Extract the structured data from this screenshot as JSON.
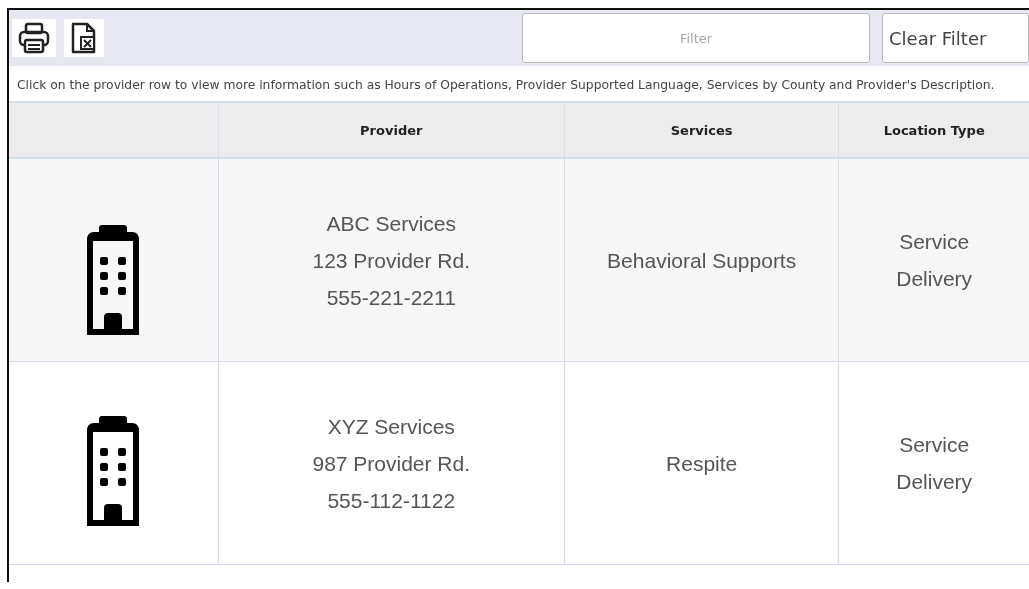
{
  "toolbar": {
    "filter": {
      "placeholder": "Filter"
    },
    "clear_button": "Clear Filter"
  },
  "instructions": "Click on the provider row to view more information such as Hours of Operations, Provider Supported Language, Services by County and Provider's Description.",
  "table": {
    "columns": [
      "Provider",
      "Services",
      "Location Type"
    ],
    "rows": [
      {
        "provider": [
          "ABC Services",
          "123 Provider Rd.",
          "555-221-2211"
        ],
        "services": "Behavioral Supports",
        "location_type": [
          "Service",
          "Delivery"
        ]
      },
      {
        "provider": [
          "XYZ Services",
          "987 Provider Rd.",
          "555-112-1122"
        ],
        "services": "Respite",
        "location_type": [
          "Service",
          "Delivery"
        ]
      }
    ]
  }
}
